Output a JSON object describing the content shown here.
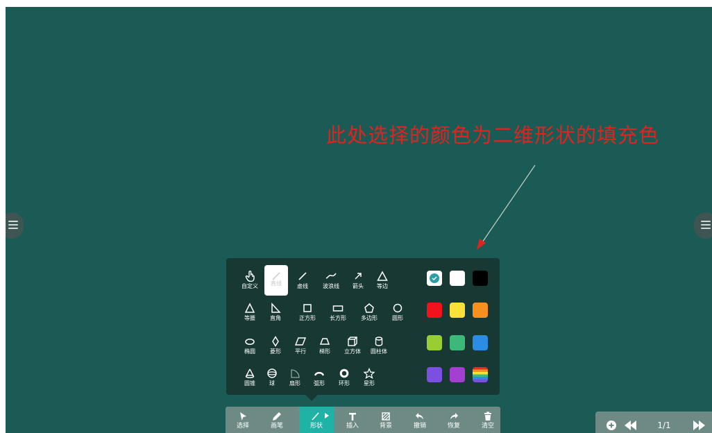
{
  "annotation": {
    "text": "此处选择的颜色为二维形状的填充色"
  },
  "shape_panel": {
    "rows": [
      [
        {
          "label": "自定义",
          "icon": "hand-pointer-icon"
        },
        {
          "label": "直线",
          "icon": "straight-line-icon",
          "selected": true
        },
        {
          "label": "虚线",
          "icon": "dashed-line-icon"
        },
        {
          "label": "波浪线",
          "icon": "wavy-line-icon"
        },
        {
          "label": "箭头",
          "icon": "arrow-icon"
        },
        {
          "label": "等边",
          "icon": "equilateral-triangle-icon"
        }
      ],
      [
        {
          "label": "等腰",
          "icon": "isosceles-triangle-icon"
        },
        {
          "label": "直角",
          "icon": "right-triangle-icon"
        },
        {
          "label": "正方形",
          "icon": "square-icon"
        },
        {
          "label": "长方形",
          "icon": "rectangle-icon"
        },
        {
          "label": "多边形",
          "icon": "pentagon-icon"
        },
        {
          "label": "圆形",
          "icon": "circle-icon"
        }
      ],
      [
        {
          "label": "椭圆",
          "icon": "ellipse-icon"
        },
        {
          "label": "菱形",
          "icon": "rhombus-icon"
        },
        {
          "label": "平行",
          "icon": "parallelogram-icon"
        },
        {
          "label": "梯形",
          "icon": "trapezoid-icon"
        },
        {
          "label": "立方体",
          "icon": "cube-icon"
        },
        {
          "label": "圆柱体",
          "icon": "cylinder-icon"
        }
      ],
      [
        {
          "label": "圆锥",
          "icon": "cone-icon"
        },
        {
          "label": "球",
          "icon": "sphere-icon"
        },
        {
          "label": "扇形",
          "icon": "sector-icon"
        },
        {
          "label": "弧形",
          "icon": "arc-icon"
        },
        {
          "label": "环形",
          "icon": "ring-icon"
        },
        {
          "label": "星形",
          "icon": "star-icon"
        }
      ]
    ],
    "colors": [
      {
        "name": "teal",
        "hex": "#1fa89e",
        "selected": true
      },
      {
        "name": "white",
        "hex": "#ffffff"
      },
      {
        "name": "black",
        "hex": "#000000"
      },
      {
        "name": "red",
        "hex": "#f0121c"
      },
      {
        "name": "yellow",
        "hex": "#fde13a"
      },
      {
        "name": "orange",
        "hex": "#f7901e"
      },
      {
        "name": "lime",
        "hex": "#9acd32"
      },
      {
        "name": "green",
        "hex": "#3cb878"
      },
      {
        "name": "blue",
        "hex": "#2c8de6"
      },
      {
        "name": "violet",
        "hex": "#7b4fe0"
      },
      {
        "name": "purple",
        "hex": "#a43fd1"
      },
      {
        "name": "rainbow",
        "hex": "rainbow"
      }
    ]
  },
  "toolbar": {
    "items": [
      {
        "label": "选择",
        "icon": "cursor-icon"
      },
      {
        "label": "画笔",
        "icon": "pen-icon"
      },
      {
        "label": "形状",
        "icon": "shape-line-icon",
        "active": true
      },
      {
        "label": "插入",
        "icon": "text-insert-icon"
      },
      {
        "label": "背景",
        "icon": "background-icon"
      },
      {
        "label": "撤销",
        "icon": "undo-icon"
      },
      {
        "label": "恢复",
        "icon": "redo-icon"
      },
      {
        "label": "清空",
        "icon": "trash-icon"
      }
    ]
  },
  "pagination": {
    "counter": "1/1"
  }
}
